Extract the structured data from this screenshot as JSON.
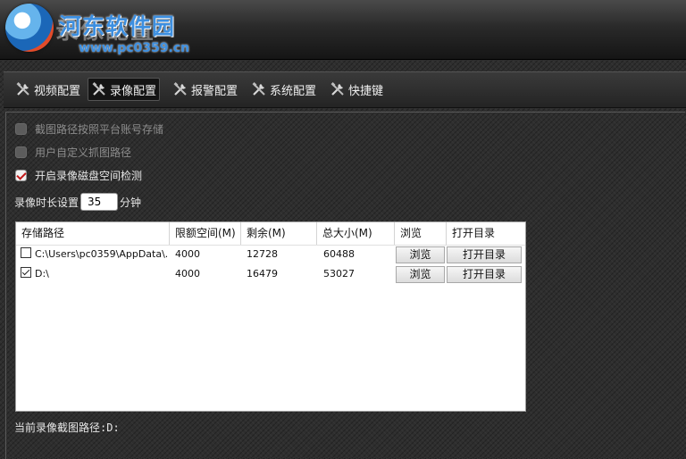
{
  "app": {
    "title": "录像配置"
  },
  "watermark": {
    "site_name": "河东软件园",
    "url": "www.pc0359.cn"
  },
  "tabs": [
    {
      "label": "视频配置",
      "icon": "tools-icon",
      "active": false
    },
    {
      "label": "录像配置",
      "icon": "tools-icon",
      "active": true
    },
    {
      "label": "报警配置",
      "icon": "tools-icon",
      "active": false
    },
    {
      "label": "系统配置",
      "icon": "tools-icon",
      "active": false
    },
    {
      "label": "快捷键",
      "icon": "tools-icon",
      "active": false
    }
  ],
  "options": [
    {
      "label": "截图路径按照平台账号存储",
      "checked": false,
      "enabled": false
    },
    {
      "label": "用户自定义抓图路径",
      "checked": false,
      "enabled": false
    },
    {
      "label": "开启录像磁盘空间检测",
      "checked": true,
      "enabled": true
    }
  ],
  "duration": {
    "label": "录像时长设置",
    "value": "35",
    "unit": "分钟"
  },
  "storage_table": {
    "headers": [
      "存储路径",
      "限额空间(M)",
      "剩余(M)",
      "总大小(M)",
      "浏览",
      "打开目录"
    ],
    "rows": [
      {
        "checked": false,
        "path": "C:\\Users\\pc0359\\AppData\\...",
        "quota": "4000",
        "remaining": "12728",
        "total": "60488",
        "browse": "浏览",
        "open_dir": "打开目录"
      },
      {
        "checked": true,
        "path": "D:\\",
        "quota": "4000",
        "remaining": "16479",
        "total": "53027",
        "browse": "浏览",
        "open_dir": "打开目录"
      }
    ]
  },
  "status": {
    "current_path": "当前录像截图路径:D:"
  },
  "colors": {
    "accent_check": "#c21a1a",
    "watermark_blue": "#3d8fe0",
    "background": "#2e2e2e"
  }
}
